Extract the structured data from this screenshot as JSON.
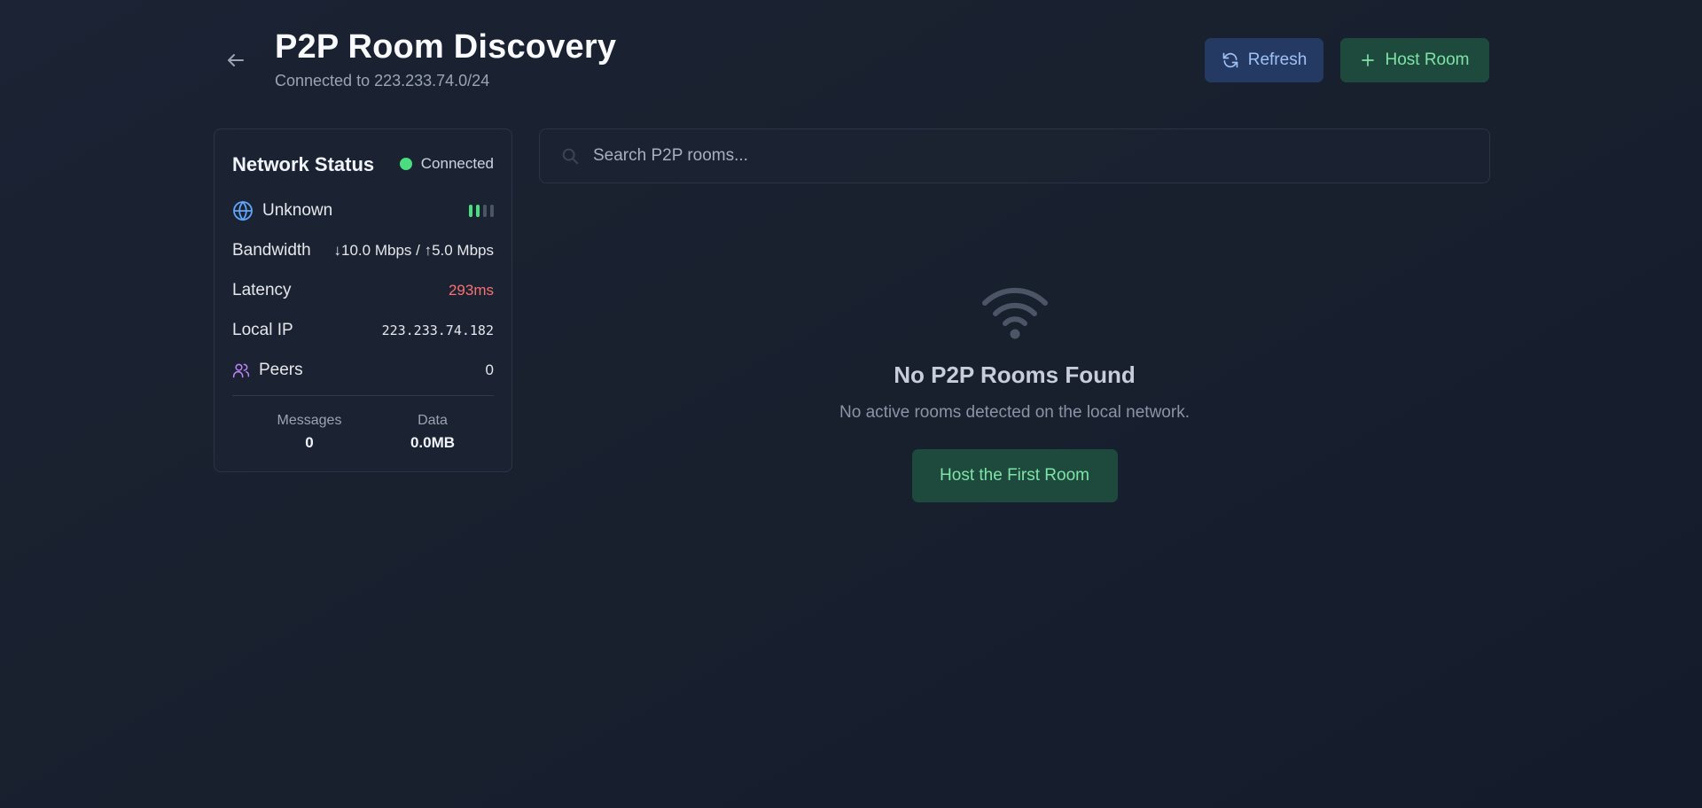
{
  "header": {
    "title": "P2P Room Discovery",
    "subtitle": "Connected to 223.233.74.0/24",
    "refresh_label": "Refresh",
    "host_label": "Host Room"
  },
  "network": {
    "title": "Network Status",
    "status": "Connected",
    "network_type": "Unknown",
    "signal_bars_active": 2,
    "signal_bars_total": 4,
    "bandwidth_label": "Bandwidth",
    "bandwidth_value": "↓10.0 Mbps / ↑5.0 Mbps",
    "latency_label": "Latency",
    "latency_value": "293ms",
    "local_ip_label": "Local IP",
    "local_ip_value": "223.233.74.182",
    "peers_label": "Peers",
    "peers_value": "0",
    "messages_label": "Messages",
    "messages_value": "0",
    "data_label": "Data",
    "data_value": "0.0MB"
  },
  "search": {
    "placeholder": "Search P2P rooms..."
  },
  "empty_state": {
    "title": "No P2P Rooms Found",
    "description": "No active rooms detected on the local network.",
    "button_label": "Host the First Room"
  },
  "colors": {
    "accent_green": "#4ade80",
    "latency_red": "#f87171",
    "refresh_bg": "#243a63",
    "host_bg": "#1e4a3e"
  }
}
